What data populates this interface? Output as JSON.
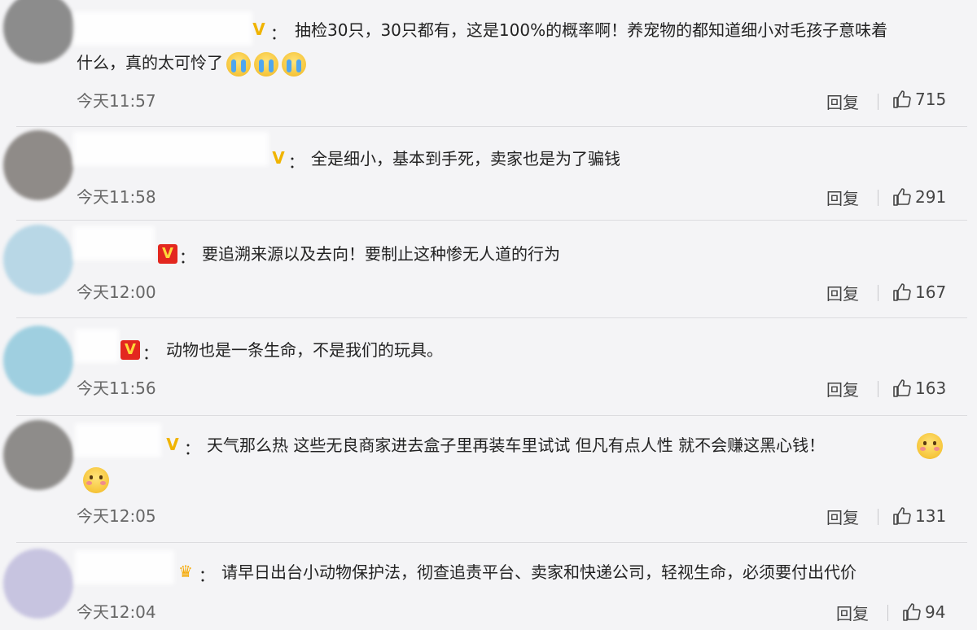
{
  "comments": [
    {
      "badge": "v-gold",
      "text": "抽检30只，30只都有，这是100%的概率啊！养宠物的都知道细小对毛孩子意味着",
      "continuation": "什么，真的太可怜了",
      "emojis": [
        "crying-face",
        "crying-face",
        "crying-face"
      ],
      "time": "今天11:57",
      "reply_label": "回复",
      "likes": "715"
    },
    {
      "badge": "v-gold",
      "text": "全是细小，基本到手死，卖家也是为了骗钱",
      "time": "今天11:58",
      "reply_label": "回复",
      "likes": "291"
    },
    {
      "badge": "v-red",
      "text": "要追溯来源以及去向！要制止这种惨无人道的行为",
      "time": "今天12:00",
      "reply_label": "回复",
      "likes": "167"
    },
    {
      "badge": "v-red",
      "text": "动物也是一条生命，不是我们的玩具。",
      "time": "今天11:56",
      "reply_label": "回复",
      "likes": "163"
    },
    {
      "badge": "v-gold",
      "text": "天气那么热 这些无良商家进去盒子里再装车里试试 但凡有点人性 就不会赚这黑心钱！",
      "emojis_inline": [
        "blushing-face"
      ],
      "emojis_next_line": [
        "blushing-face"
      ],
      "time": "今天12:05",
      "reply_label": "回复",
      "likes": "131"
    },
    {
      "badge": "crown",
      "text": "请早日出台小动物保护法，彻查追责平台、卖家和快递公司，轻视生命，必须要付出代价",
      "time": "今天12:04",
      "reply_label": "回复",
      "likes": "94"
    }
  ],
  "colon": "：",
  "badge_glyphs": {
    "v-gold": "V",
    "v-red": "V",
    "crown": "♛"
  },
  "colors": {
    "background": "#f4f4f6",
    "text": "#222222",
    "meta": "#666666",
    "gold_badge": "#f0b400",
    "red_badge": "#e3271f"
  }
}
